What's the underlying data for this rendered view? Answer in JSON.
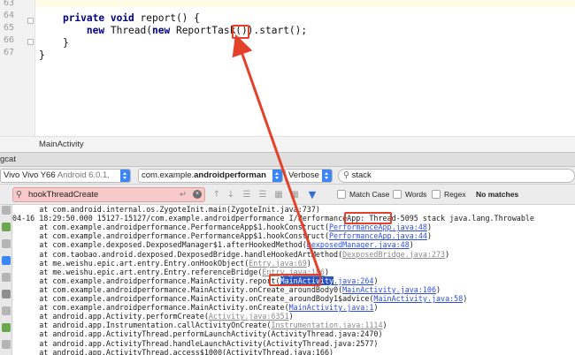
{
  "editor": {
    "line_numbers": [
      "63",
      "64",
      "65",
      "66",
      "67"
    ],
    "lines": [
      {
        "indent": "    ",
        "parts": [
          {
            "t": "private ",
            "kw": true
          },
          {
            "t": "void ",
            "kw": true
          },
          {
            "t": "report() {"
          }
        ]
      },
      {
        "indent": "        ",
        "parts": [
          {
            "t": "new ",
            "kw": true
          },
          {
            "t": "Thread("
          },
          {
            "t": "new ",
            "kw": true
          },
          {
            "t": "ReportTask()).start();"
          }
        ]
      },
      {
        "indent": "    ",
        "parts": [
          {
            "t": "}"
          }
        ]
      },
      {
        "indent": "",
        "parts": [
          {
            "t": "}"
          }
        ]
      },
      {
        "indent": "",
        "parts": [
          {
            "t": ""
          }
        ]
      }
    ]
  },
  "breadcrumb": {
    "label": "MainActivity"
  },
  "logcat": {
    "title": "gcat",
    "device": {
      "name": "Vivo Vivo Y66",
      "detail": "Android 6.0.1,"
    },
    "process": {
      "prefix": "com.example.",
      "bold": "androidperforman"
    },
    "level": "Verbose",
    "search": {
      "value": "stack"
    },
    "hook_filter": {
      "value": "hookThreadCreate"
    },
    "options": {
      "match_case": "Match Case",
      "words": "Words",
      "regex": "Regex",
      "result": "No matches"
    },
    "lines": [
      {
        "parts": [
          {
            "t": "      at com.android.internal.os.ZygoteInit.main(ZygoteInit.java:737)"
          }
        ]
      },
      {
        "parts": [
          {
            "t": "04-16 18:29:50.000 15127-15127/com.example.androidperformance I/PerformanceApp: "
          },
          {
            "t": "Thread-5095"
          },
          {
            "t": " stack java.lang.Throwable"
          }
        ]
      },
      {
        "parts": [
          {
            "t": "      at com.example.androidperformance.PerformanceApp$1.hookConstruct("
          },
          {
            "t": "PerformanceApp.java:48",
            "c": "lk"
          },
          {
            "t": ")"
          }
        ]
      },
      {
        "parts": [
          {
            "t": "      at com.example.androidperformance.PerformanceApp$1.hookConstruct("
          },
          {
            "t": "PerformanceApp.java:44",
            "c": "lk"
          },
          {
            "t": ")"
          }
        ]
      },
      {
        "parts": [
          {
            "t": "      at com.example.dexposed.DexposedManager$1.afterHookedMethod("
          },
          {
            "t": "DexposedManager.java:48",
            "c": "lk"
          },
          {
            "t": ")"
          }
        ]
      },
      {
        "parts": [
          {
            "t": "      at com.taobao.android.dexposed.DexposedBridge.handleHookedArtMethod("
          },
          {
            "t": "DexposedBridge.java:273",
            "c": "lg"
          },
          {
            "t": ")"
          }
        ]
      },
      {
        "parts": [
          {
            "t": "      at me.weishu.epic.art.entry.Entry.onHookObject("
          },
          {
            "t": "Entry.java:69",
            "c": "lg"
          },
          {
            "t": ")"
          }
        ]
      },
      {
        "parts": [
          {
            "t": "      at me.weishu.epic.art.entry.Entry.referenceBridge("
          },
          {
            "t": "Entry.java:186",
            "c": "lg"
          },
          {
            "t": ")"
          }
        ]
      },
      {
        "parts": [
          {
            "t": "      at com.example.androidperformance.MainActivity.report("
          },
          {
            "t": "MainActivity",
            "c": "sel"
          },
          {
            "t": ".java:264",
            "c": "lk"
          },
          {
            "t": ")"
          }
        ]
      },
      {
        "parts": [
          {
            "t": "      at com.example.androidperformance.MainActivity.onCreate_aroundBody0("
          },
          {
            "t": "MainActivity.java:106",
            "c": "lk"
          },
          {
            "t": ")"
          }
        ]
      },
      {
        "parts": [
          {
            "t": "      at com.example.androidperformance.MainActivity.onCreate_aroundBody1$advice("
          },
          {
            "t": "MainActivity.java:58",
            "c": "lk"
          },
          {
            "t": ")"
          }
        ]
      },
      {
        "parts": [
          {
            "t": "      at com.example.androidperformance.MainActivity.onCreate("
          },
          {
            "t": "MainActivity.java:1",
            "c": "lk"
          },
          {
            "t": ")"
          }
        ]
      },
      {
        "parts": [
          {
            "t": "      at android.app.Activity.performCreate("
          },
          {
            "t": "Activity.java:6351",
            "c": "lg"
          },
          {
            "t": ")"
          }
        ]
      },
      {
        "parts": [
          {
            "t": "      at android.app.Instrumentation.callActivityOnCreate("
          },
          {
            "t": "Instrumentation.java:1114",
            "c": "lg"
          },
          {
            "t": ")"
          }
        ]
      },
      {
        "parts": [
          {
            "t": "      at android.app.ActivityThread.performLaunchActivity(ActivityThread.java:2470)"
          }
        ]
      },
      {
        "parts": [
          {
            "t": "      at android.app.ActivityThread.handleLaunchActivity(ActivityThread.java:2577)"
          }
        ]
      },
      {
        "parts": [
          {
            "t": "      at android.app.ActivityThread.access$1000(ActivityThread.java:166)"
          }
        ]
      }
    ]
  },
  "colors": {
    "annotation": "#e4412a",
    "selection": "#2954c9",
    "link": "#2e4ee0",
    "keyword": "#000080"
  },
  "icons": [
    "search-icon",
    "clear-icon",
    "up-arrow-icon",
    "down-arrow-icon",
    "funnel-icon"
  ]
}
